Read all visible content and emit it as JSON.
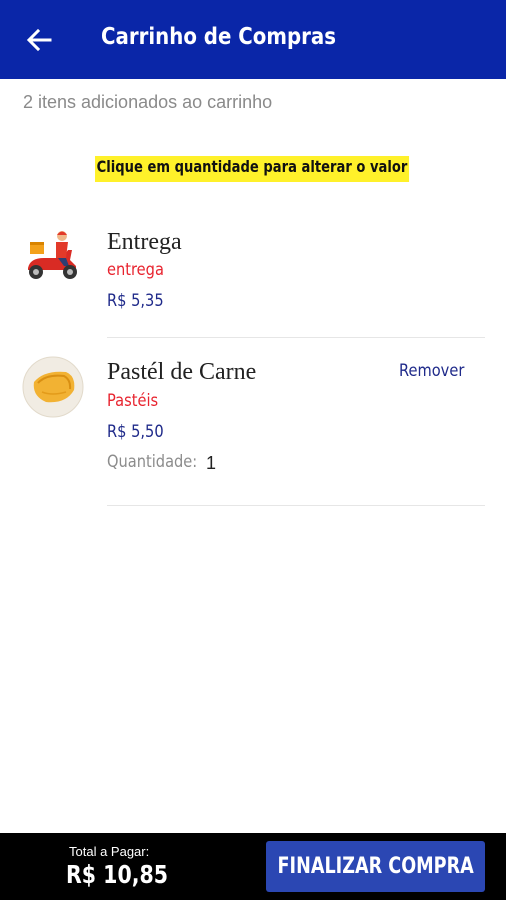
{
  "header": {
    "title": "Carrinho de Compras",
    "back_icon": "arrow-left-icon",
    "background": "#0a26a8"
  },
  "cart": {
    "count_text": "2 itens adicionados ao carrinho",
    "hint": "Clique em quantidade para alterar o valor"
  },
  "items": [
    {
      "name": "Entrega",
      "category": "entrega",
      "price": "R$ 5,35",
      "icon": "delivery-scooter-icon"
    },
    {
      "name": "Pastél de Carne",
      "category": "Pastéis",
      "price": "R$ 5,50",
      "quantity_label": "Quantidade:",
      "quantity": "1",
      "remove_label": "Remover",
      "icon": "pastel-icon"
    }
  ],
  "footer": {
    "total_label": "Total a Pagar:",
    "total_value": "R$ 10,85",
    "checkout_label": "FINALIZAR COMPRA",
    "button_color": "#2b47b3"
  }
}
